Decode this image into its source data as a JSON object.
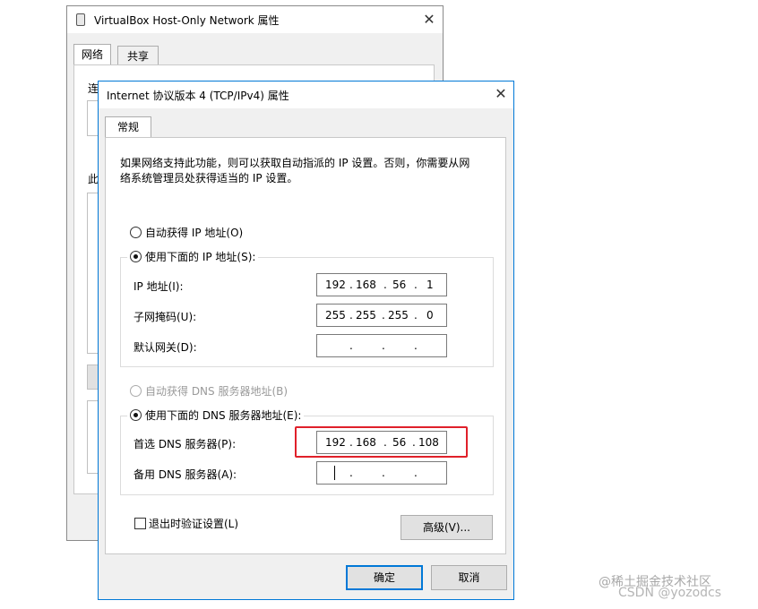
{
  "back_window": {
    "title": "VirtualBox Host-Only Network 属性",
    "tabs": [
      "网络",
      "共享"
    ],
    "fragment_connect": "连",
    "fragment_this": "此"
  },
  "dialog": {
    "title": "Internet 协议版本 4 (TCP/IPv4) 属性",
    "tab": "常规",
    "description_line1": "如果网络支持此功能，则可以获取自动指派的 IP 设置。否则，你需要从网",
    "description_line2": "络系统管理员处获得适当的 IP 设置。",
    "ip_auto_label": "自动获得 IP 地址(O)",
    "ip_manual_label": "使用下面的 IP 地址(S):",
    "ip_fields": [
      {
        "label": "IP 地址(I):",
        "octets": [
          "192",
          "168",
          "56",
          "1"
        ]
      },
      {
        "label": "子网掩码(U):",
        "octets": [
          "255",
          "255",
          "255",
          "0"
        ]
      },
      {
        "label": "默认网关(D):",
        "octets": [
          "",
          "",
          "",
          ""
        ]
      }
    ],
    "dns_auto_label": "自动获得 DNS 服务器地址(B)",
    "dns_manual_label": "使用下面的 DNS 服务器地址(E):",
    "dns_fields": [
      {
        "label": "首选 DNS 服务器(P):",
        "octets": [
          "192",
          "168",
          "56",
          "108"
        ]
      },
      {
        "label": "备用 DNS 服务器(A):",
        "octets": [
          "",
          "",
          "",
          ""
        ]
      }
    ],
    "validate_label": "退出时验证设置(L)",
    "advanced_button": "高级(V)...",
    "ok_button": "确定",
    "cancel_button": "取消"
  },
  "watermark": {
    "line1": "@稀土掘金技术社区",
    "line2": "CSDN @yozodcs"
  },
  "colors": {
    "highlight": "#e0202a",
    "accent": "#0078d7"
  }
}
